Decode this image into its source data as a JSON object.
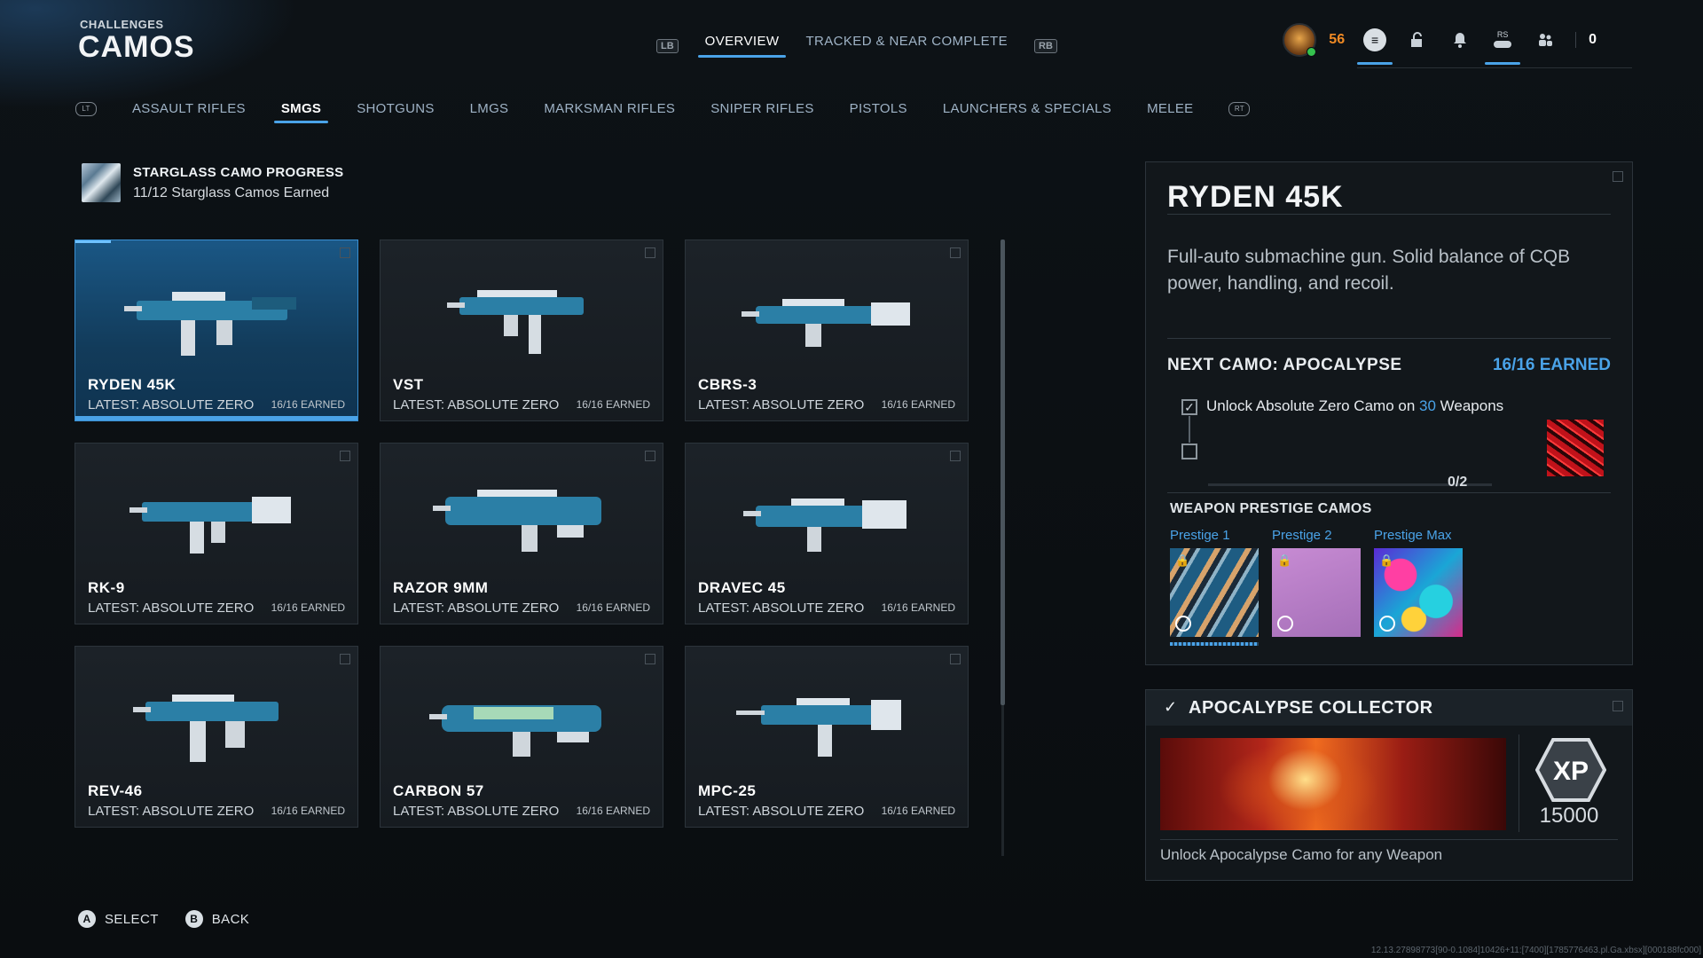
{
  "header": {
    "subtitle": "CHALLENGES",
    "title": "CAMOS"
  },
  "topnav": {
    "left_bumper": "LB",
    "right_bumper": "RB",
    "tabs": [
      {
        "label": "OVERVIEW",
        "active": true
      },
      {
        "label": "TRACKED & NEAR COMPLETE",
        "active": false
      }
    ]
  },
  "hud": {
    "level": "56",
    "rs_label": "RS",
    "count": "0"
  },
  "categories": {
    "items": [
      {
        "label": "ASSAULT RIFLES",
        "active": false
      },
      {
        "label": "SMGS",
        "active": true
      },
      {
        "label": "SHOTGUNS",
        "active": false
      },
      {
        "label": "LMGS",
        "active": false
      },
      {
        "label": "MARKSMAN RIFLES",
        "active": false
      },
      {
        "label": "SNIPER RIFLES",
        "active": false
      },
      {
        "label": "PISTOLS",
        "active": false
      },
      {
        "label": "LAUNCHERS & SPECIALS",
        "active": false
      },
      {
        "label": "MELEE",
        "active": false
      }
    ]
  },
  "progress": {
    "title": "STARGLASS CAMO PROGRESS",
    "subtitle": "11/12 Starglass Camos Earned"
  },
  "weapons": [
    {
      "name": "RYDEN 45K",
      "latest": "LATEST: ABSOLUTE ZERO",
      "earned": "16/16 EARNED",
      "selected": true
    },
    {
      "name": "VST",
      "latest": "LATEST: ABSOLUTE ZERO",
      "earned": "16/16 EARNED",
      "selected": false
    },
    {
      "name": "CBRS-3",
      "latest": "LATEST: ABSOLUTE ZERO",
      "earned": "16/16 EARNED",
      "selected": false
    },
    {
      "name": "RK-9",
      "latest": "LATEST: ABSOLUTE ZERO",
      "earned": "16/16 EARNED",
      "selected": false
    },
    {
      "name": "RAZOR 9MM",
      "latest": "LATEST: ABSOLUTE ZERO",
      "earned": "16/16 EARNED",
      "selected": false
    },
    {
      "name": "DRAVEC 45",
      "latest": "LATEST: ABSOLUTE ZERO",
      "earned": "16/16 EARNED",
      "selected": false
    },
    {
      "name": "REV-46",
      "latest": "LATEST: ABSOLUTE ZERO",
      "earned": "16/16 EARNED",
      "selected": false
    },
    {
      "name": "CARBON 57",
      "latest": "LATEST: ABSOLUTE ZERO",
      "earned": "16/16 EARNED",
      "selected": false
    },
    {
      "name": "MPC-25",
      "latest": "LATEST: ABSOLUTE ZERO",
      "earned": "16/16 EARNED",
      "selected": false
    }
  ],
  "detail": {
    "title": "RYDEN 45K",
    "description": "Full-auto submachine gun. Solid balance of CQB power, handling, and recoil.",
    "next_camo": "NEXT CAMO: APOCALYPSE",
    "earned": "16/16 EARNED",
    "task_prefix": "Unlock Absolute Zero Camo on ",
    "task_highlight": "30",
    "task_suffix": " Weapons",
    "task_progress": "0/2",
    "prestige_header": "WEAPON PRESTIGE CAMOS",
    "prestige": [
      {
        "label": "Prestige 1"
      },
      {
        "label": "Prestige 2"
      },
      {
        "label": "Prestige Max"
      }
    ]
  },
  "collector": {
    "title": "APOCALYPSE COLLECTOR",
    "xp_label": "XP",
    "xp_value": "15000",
    "description": "Unlock Apocalypse Camo for any Weapon"
  },
  "footer": {
    "select_glyph": "A",
    "select_label": "SELECT",
    "back_glyph": "B",
    "back_label": "BACK"
  },
  "build_string": "12.13.27898773[90-0.1084]10426+11:[7400][1785776463.pl.Ga.xbsx][000188fc000]",
  "colors": {
    "accent": "#4aa3e8",
    "level": "#f08a24",
    "selected_card": "#1a5785"
  }
}
